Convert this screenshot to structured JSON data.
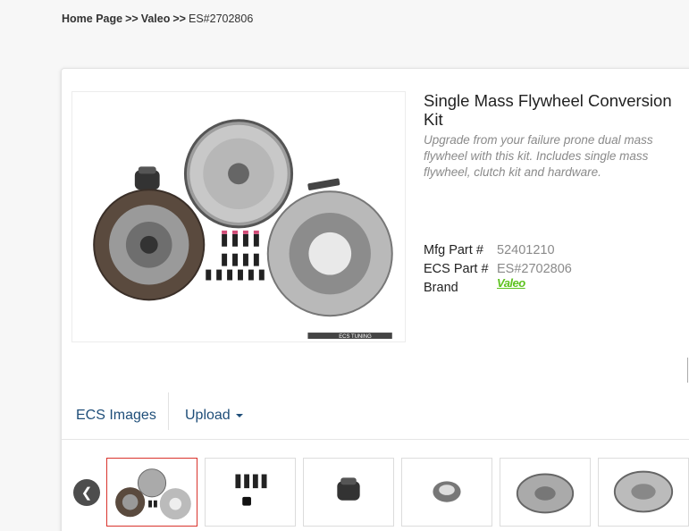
{
  "breadcrumb": {
    "home": "Home Page",
    "separator1": ">>",
    "brand": "Valeo",
    "separator2": ">>",
    "current": "ES#2702806"
  },
  "product": {
    "title": "Single Mass Flywheel Conversion Kit",
    "subtitle": "Upgrade from your failure prone dual mass flywheel with this kit. Includes single mass flywheel, clutch kit and hardware.",
    "mfg_label": "Mfg Part #",
    "mfg_value": "52401210",
    "ecs_label": "ECS Part #",
    "ecs_value": "ES#2702806",
    "brand_label": "Brand",
    "brand_logo_text": "Valeo"
  },
  "gallery": {
    "tabs": [
      "ECS Images",
      "Upload"
    ],
    "prev_icon": "chevron-left-icon",
    "thumbnails": [
      {
        "name": "thumb-kit",
        "active": true
      },
      {
        "name": "thumb-bolts",
        "active": false
      },
      {
        "name": "thumb-release-bearing",
        "active": false
      },
      {
        "name": "thumb-pilot-bearing",
        "active": false
      },
      {
        "name": "thumb-flywheel-front",
        "active": false
      },
      {
        "name": "thumb-flywheel-back",
        "active": false
      }
    ],
    "watermark": "ECS TUNING"
  },
  "colors": {
    "link": "#1f4e79",
    "brand_green": "#5dc21e",
    "active_border": "#d9332c"
  }
}
